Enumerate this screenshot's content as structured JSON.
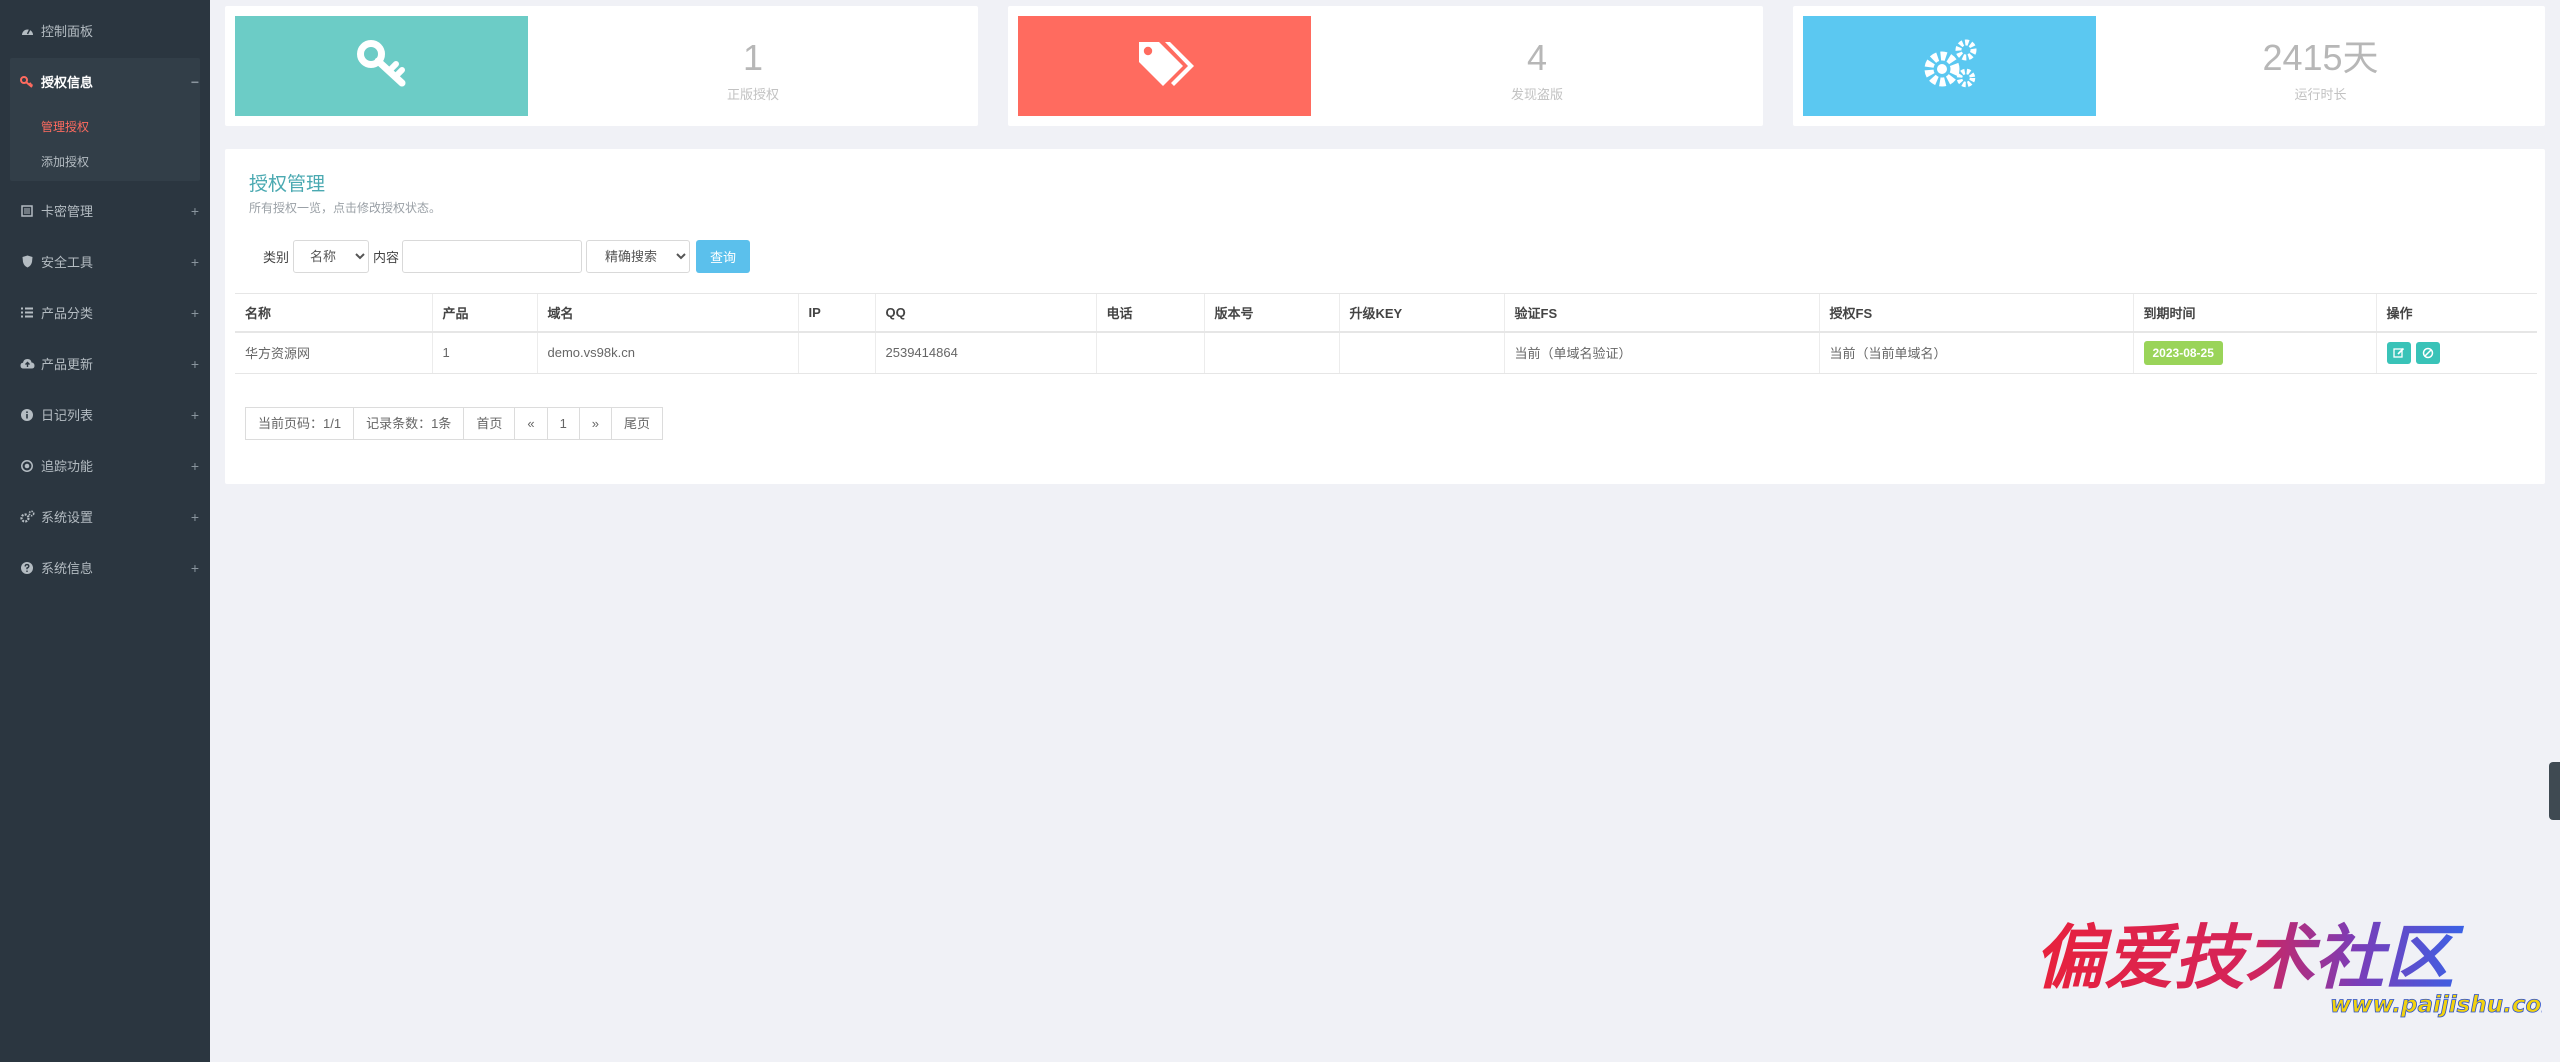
{
  "sidebar": {
    "items": [
      {
        "label": "控制面板",
        "icon": "dashboard-icon",
        "toggle": ""
      },
      {
        "label": "授权信息",
        "icon": "key-icon",
        "toggle": "−"
      },
      {
        "label": "卡密管理",
        "icon": "list-alt-icon",
        "toggle": "+"
      },
      {
        "label": "安全工具",
        "icon": "shield-icon",
        "toggle": "+"
      },
      {
        "label": "产品分类",
        "icon": "list-icon",
        "toggle": "+"
      },
      {
        "label": "产品更新",
        "icon": "cloud-upload-icon",
        "toggle": "+"
      },
      {
        "label": "日记列表",
        "icon": "info-icon",
        "toggle": "+"
      },
      {
        "label": "追踪功能",
        "icon": "target-icon",
        "toggle": "+"
      },
      {
        "label": "系统设置",
        "icon": "gears-icon",
        "toggle": "+"
      },
      {
        "label": "系统信息",
        "icon": "question-icon",
        "toggle": "+"
      }
    ],
    "subitems": [
      {
        "label": "管理授权",
        "current": true
      },
      {
        "label": "添加授权",
        "current": false
      }
    ]
  },
  "stats": [
    {
      "value": "1",
      "caption": "正版授权",
      "color": "#6cccc6",
      "icon": "key-icon"
    },
    {
      "value": "4",
      "caption": "发现盗版",
      "color": "#ff6b5f",
      "icon": "tags-icon"
    },
    {
      "value": "2415天",
      "caption": "运行时长",
      "color": "#5bc8f1",
      "icon": "gears-icon"
    }
  ],
  "panel": {
    "title": "授权管理",
    "subtitle": "所有授权一览，点击修改授权状态。"
  },
  "filter": {
    "category_label": "类别",
    "category_value": "名称",
    "content_label": "内容",
    "content_value": "",
    "mode_value": "精确搜索",
    "query_label": "查询"
  },
  "table": {
    "columns": [
      "名称",
      "产品",
      "域名",
      "IP",
      "QQ",
      "电话",
      "版本号",
      "升级KEY",
      "验证FS",
      "授权FS",
      "到期时间",
      "操作"
    ],
    "rows": [
      {
        "name": "华方资源网",
        "product": "1",
        "domain": "demo.vs98k.cn",
        "ip": "",
        "qq": "2539414864",
        "phone": "",
        "version": "",
        "upgrade_key": "",
        "verify_fs": "当前（单域名验证）",
        "auth_fs": "当前（当前单域名）",
        "expire": "2023-08-25"
      }
    ]
  },
  "pager": {
    "current_page": "当前页码：1/1",
    "record_count": "记录条数：1条",
    "first": "首页",
    "prev": "«",
    "page": "1",
    "next": "»",
    "last": "尾页"
  },
  "watermark": {
    "title": "偏爱技术社区",
    "url": "www.paijishu.com"
  },
  "colors": {
    "sidebar_bg": "#2b3640",
    "accent_teal": "#4aa9b1",
    "active_red": "#ff6b5f",
    "query_blue": "#5bc0ec",
    "badge_green": "#9ad459",
    "action_teal": "#39c3b8"
  }
}
